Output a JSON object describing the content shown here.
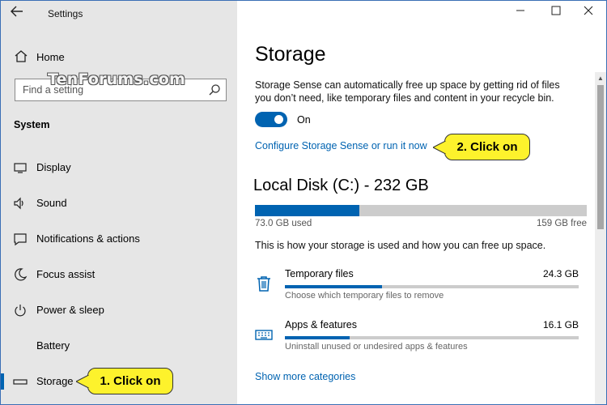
{
  "window": {
    "title": "Settings",
    "controls": [
      "minimize",
      "maximize",
      "close"
    ]
  },
  "sidebar": {
    "home_label": "Home",
    "search_placeholder": "Find a setting",
    "watermark": "TenForums.com",
    "section_title": "System",
    "items": [
      {
        "label": "Display",
        "icon": "display-icon"
      },
      {
        "label": "Sound",
        "icon": "sound-icon"
      },
      {
        "label": "Notifications & actions",
        "icon": "notifications-icon"
      },
      {
        "label": "Focus assist",
        "icon": "focus-assist-icon"
      },
      {
        "label": "Power & sleep",
        "icon": "power-icon"
      },
      {
        "label": "Battery",
        "icon": "battery-icon"
      },
      {
        "label": "Storage",
        "icon": "storage-icon",
        "selected": true
      }
    ]
  },
  "main": {
    "title": "Storage",
    "description": "Storage Sense can automatically free up space by getting rid of files you don’t need, like temporary files and content in your recycle bin.",
    "toggle": {
      "state": "On",
      "on": true
    },
    "configure_link": "Configure Storage Sense or run it now",
    "disk": {
      "title": "Local Disk (C:) - 232 GB",
      "used_label": "73.0 GB used",
      "free_label": "159 GB free",
      "used_fraction": 0.315
    },
    "usage_hint": "This is how your storage is used and how you can free up space.",
    "categories": [
      {
        "name": "Temporary files",
        "size": "24.3 GB",
        "sub": "Choose which temporary files to remove",
        "fraction": 0.33,
        "icon": "trash-icon"
      },
      {
        "name": "Apps & features",
        "size": "16.1 GB",
        "sub": "Uninstall unused or undesired apps & features",
        "fraction": 0.22,
        "icon": "keyboard-icon"
      }
    ],
    "more_link": "Show more categories"
  },
  "callouts": {
    "one": "1. Click on",
    "two": "2. Click on"
  },
  "colors": {
    "accent": "#0063b1",
    "sidebar_bg": "#e6e6e6",
    "callout_bg": "#fdf22c"
  }
}
